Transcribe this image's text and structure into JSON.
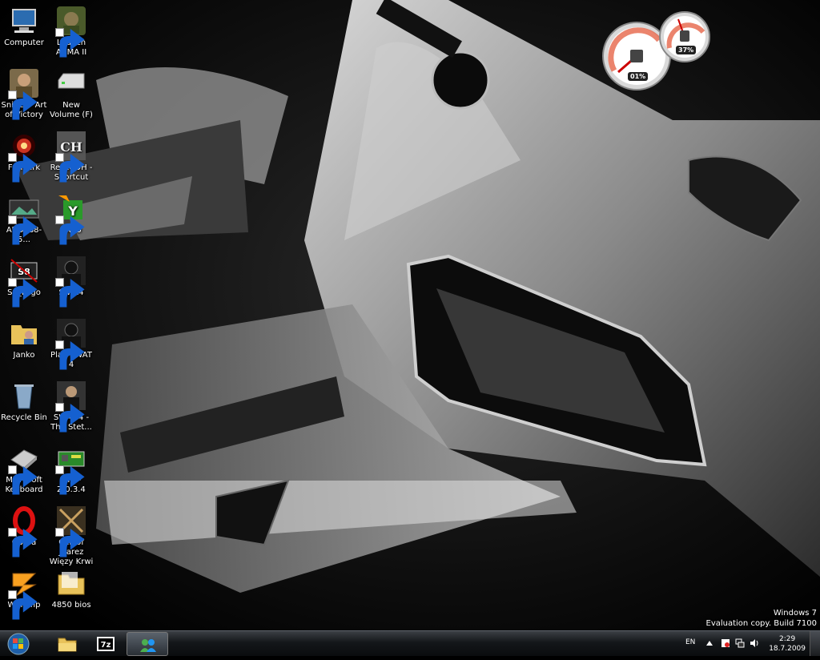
{
  "desktop": {
    "icons": [
      {
        "label": "Computer",
        "icon": "computer-icon"
      },
      {
        "label": "Launch ARMA II",
        "icon": "arma-icon"
      },
      {
        "label": "Sniper - Art of Victory",
        "icon": "sniper-icon"
      },
      {
        "label": "New Volume (F)",
        "icon": "drive-icon"
      },
      {
        "label": "FurMark",
        "icon": "furmark-icon"
      },
      {
        "label": "RelicCOH - Shortcut",
        "icon": "coh-icon"
      },
      {
        "label": "AUDI S8-5...",
        "icon": "image-icon"
      },
      {
        "label": "YASU",
        "icon": "yasu-icon"
      },
      {
        "label": "S8_Logo",
        "icon": "s8-logo-icon"
      },
      {
        "label": "Swat4",
        "icon": "swat-icon"
      },
      {
        "label": "Janko",
        "icon": "user-folder-icon"
      },
      {
        "label": "Play SWAT 4",
        "icon": "swat-icon"
      },
      {
        "label": "Recycle Bin",
        "icon": "recycle-bin-icon"
      },
      {
        "label": "SWAT 4 - The Stet...",
        "icon": "swat-stetchkov-icon"
      },
      {
        "label": "Microsoft Keyboard",
        "icon": "keyboard-icon"
      },
      {
        "label": "GPU-Z.0.3.4",
        "icon": "gpu-z-icon"
      },
      {
        "label": "Opera",
        "icon": "opera-icon"
      },
      {
        "label": "Call of Juarez Więzy Krwi",
        "icon": "call-of-juarez-icon"
      },
      {
        "label": "Winamp",
        "icon": "winamp-icon"
      },
      {
        "label": "4850 bios",
        "icon": "folder-icon"
      }
    ]
  },
  "gadget": {
    "cpu_label": "01%",
    "ram_label": "37%",
    "cpu_value": 0.01,
    "ram_value": 0.37
  },
  "watermark": {
    "line1": "Windows 7",
    "line2": "Evaluation copy. Build 7100"
  },
  "taskbar": {
    "pinned": [
      "explorer-icon",
      "7zip-icon",
      "messenger-icon"
    ],
    "language": "EN",
    "time": "2:29",
    "date": "18.7.2009"
  }
}
